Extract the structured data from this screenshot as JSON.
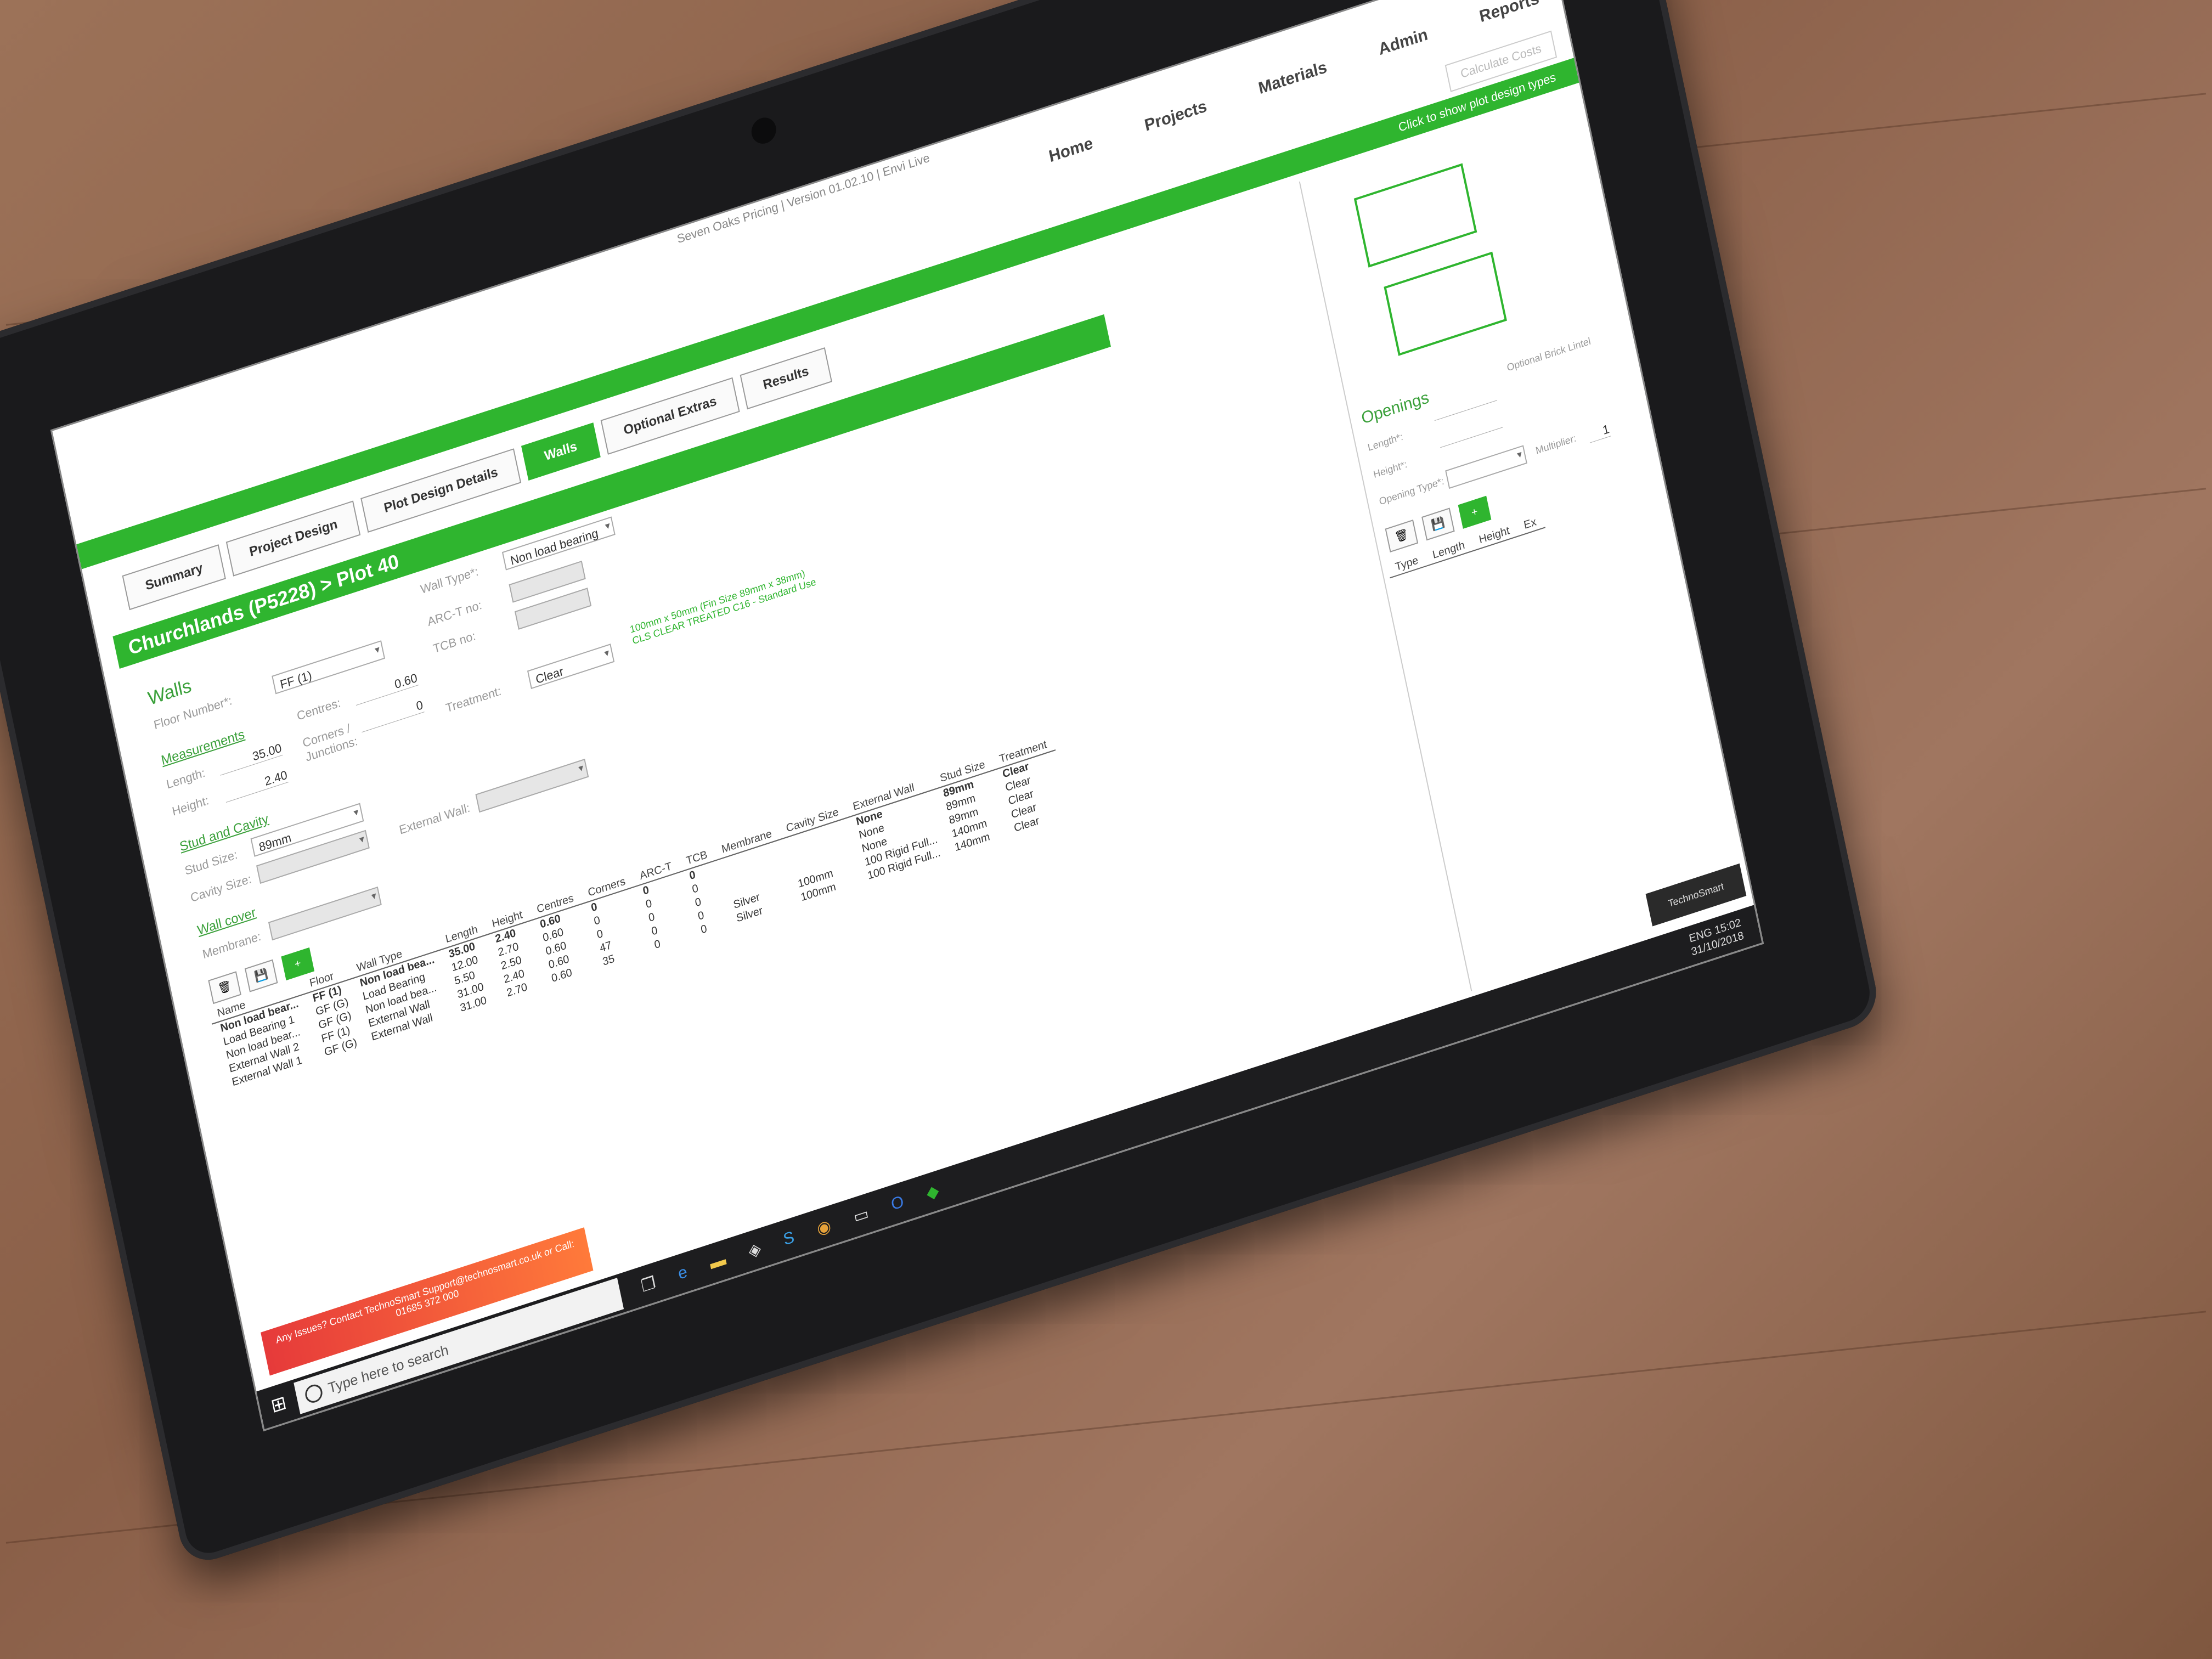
{
  "window": {
    "title": "Seven Oaks Pricing | Version 01.02.10 | Envi Live",
    "controls": "— ▢ ✕"
  },
  "nav": [
    "Home",
    "Projects",
    "Materials",
    "Admin",
    "Reports"
  ],
  "calculate_label": "Calculate Costs",
  "green_bar_text": "Click to show plot design types",
  "tabs": [
    "Summary",
    "Project Design",
    "Plot Design Details",
    "Walls",
    "Optional Extras",
    "Results"
  ],
  "active_tab": "Walls",
  "plot_title": "Churchlands (P5228) > Plot 40",
  "walls": {
    "heading": "Walls",
    "floor_label": "Floor Number*:",
    "floor_value": "FF (1)",
    "wall_type_label": "Wall Type*:",
    "wall_type_value": "Non load bearing",
    "arc_label": "ARC-T no:",
    "tcb_label": "TCB no:",
    "measurements_heading": "Measurements",
    "length_label": "Length:",
    "length_value": "35.00",
    "height_label": "Height:",
    "height_value": "2.40",
    "centres_label": "Centres:",
    "centres_value": "0.60",
    "corners_label": "Corners / Junctions:",
    "corners_value": "0",
    "treatment_label": "Treatment:",
    "treatment_value": "Clear",
    "note": "100mm x 50mm (Fin Size 89mm x 38mm) CLS CLEAR TREATED C16 - Standard Use",
    "stud_heading": "Stud and Cavity",
    "stud_size_label": "Stud Size:",
    "stud_size_value": "89mm",
    "cavity_size_label": "Cavity Size:",
    "external_wall_label": "External Wall:",
    "wall_cover_heading": "Wall cover",
    "membrane_label": "Membrane:"
  },
  "table": {
    "headers": [
      "Name",
      "Floor",
      "Wall Type",
      "Length",
      "Height",
      "Centres",
      "Corners",
      "ARC-T",
      "TCB",
      "Membrane",
      "Cavity Size",
      "External Wall",
      "Stud Size",
      "Treatment"
    ],
    "rows": [
      [
        "Non load bear...",
        "FF (1)",
        "Non load bea...",
        "35.00",
        "2.40",
        "0.60",
        "0",
        "0",
        "0",
        "",
        "",
        "None",
        "89mm",
        "Clear"
      ],
      [
        "Load Bearing 1",
        "GF (G)",
        "Load Bearing",
        "12.00",
        "2.70",
        "0.60",
        "0",
        "0",
        "0",
        "",
        "",
        "None",
        "89mm",
        "Clear"
      ],
      [
        "Non load bear...",
        "GF (G)",
        "Non load bea...",
        "5.50",
        "2.50",
        "0.60",
        "0",
        "0",
        "0",
        "",
        "",
        "None",
        "89mm",
        "Clear"
      ],
      [
        "External Wall 2",
        "FF (1)",
        "External Wall",
        "31.00",
        "2.40",
        "0.60",
        "47",
        "0",
        "0",
        "Silver",
        "100mm",
        "100 Rigid Full...",
        "140mm",
        "Clear"
      ],
      [
        "External Wall 1",
        "GF (G)",
        "External Wall",
        "31.00",
        "2.70",
        "0.60",
        "35",
        "0",
        "0",
        "Silver",
        "100mm",
        "100 Rigid Full...",
        "140mm",
        "Clear"
      ]
    ]
  },
  "openings": {
    "heading": "Openings",
    "optional_label": "Optional Brick Lintel",
    "length_label": "Length*:",
    "height_label": "Height*:",
    "type_label": "Opening Type*:",
    "multiplier_label": "Multiplier:",
    "multiplier_value": "1",
    "headers": [
      "Type",
      "Length",
      "Height",
      "Ex"
    ]
  },
  "support_text": "Any Issues? Contact TechnoSmart Support@technosmart.co.uk or Call: 01685 372 000",
  "brand_text": "TechnoSmart",
  "taskbar": {
    "search_placeholder": "Type here to search",
    "tray_lang": "ENG",
    "time": "15:02",
    "date": "31/10/2018"
  },
  "colors": {
    "accent": "#2fb52f",
    "support_start": "#e63a3a",
    "support_end": "#ff7a3a"
  }
}
